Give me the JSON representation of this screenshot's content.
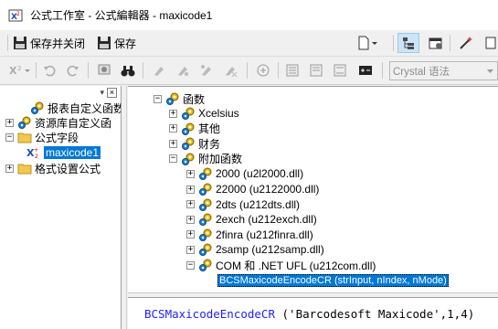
{
  "window": {
    "title": "公式工作室 - 公式編輯器 - maxicode1"
  },
  "toolbar1": {
    "save_close_label": "保存并关闭",
    "save_label": "保存"
  },
  "toolbar2": {
    "syntax_value": "Crystal 语法"
  },
  "left_tree": {
    "items": [
      {
        "label": "报表自定义函数",
        "expander": "",
        "icon": "gear-icon"
      },
      {
        "label": "资源库自定义函",
        "expander": "+",
        "icon": "gear-icon"
      },
      {
        "label": "公式字段",
        "expander": "-",
        "icon": "folder-icon"
      },
      {
        "label": "maxicode1",
        "expander": "",
        "icon": "formula-icon",
        "selected": true
      },
      {
        "label": "格式设置公式",
        "expander": "+",
        "icon": "folder-icon"
      }
    ]
  },
  "func_tree": {
    "root": "函数",
    "items": [
      {
        "label": "Xcelsius",
        "level": 1,
        "expander": "+"
      },
      {
        "label": "其他",
        "level": 1,
        "expander": "+"
      },
      {
        "label": "财务",
        "level": 1,
        "expander": "+"
      },
      {
        "label": "附加函数",
        "level": 1,
        "expander": "-"
      },
      {
        "label": "2000 (u2l2000.dll)",
        "level": 2,
        "expander": "+"
      },
      {
        "label": "22000 (u2122000.dll)",
        "level": 2,
        "expander": "+"
      },
      {
        "label": "2dts (u212dts.dll)",
        "level": 2,
        "expander": "+"
      },
      {
        "label": "2exch (u212exch.dll)",
        "level": 2,
        "expander": "+"
      },
      {
        "label": "2finra (u212finra.dll)",
        "level": 2,
        "expander": "+"
      },
      {
        "label": "2samp (u212samp.dll)",
        "level": 2,
        "expander": "+"
      },
      {
        "label": "COM 和 .NET UFL (u212com.dll)",
        "level": 2,
        "expander": "-"
      }
    ],
    "selected_function": "BCSMaxicodeEncodeCR (strInput, nIndex, nMode)"
  },
  "editor": {
    "function_name": "BCSMaxicodeEncodeCR",
    "arguments": " ('Barcodesoft Maxicode',1,4)"
  }
}
